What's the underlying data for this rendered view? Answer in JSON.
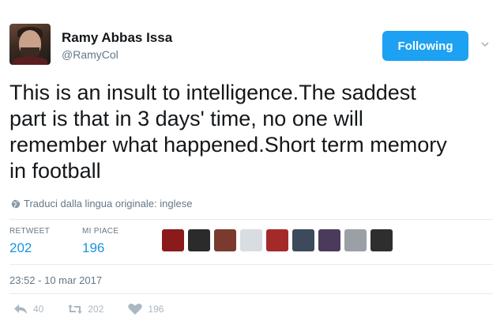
{
  "author": {
    "name": "Ramy Abbas Issa",
    "handle": "@RamyCol"
  },
  "follow_button": {
    "label": "Following"
  },
  "tweet": {
    "text": "This is an insult to intelligence.The saddest\npart is that in 3 days' time, no one will\nremember what happened.Short term memory\nin football"
  },
  "translate": {
    "label": "Traduci dalla lingua originale: inglese",
    "icon": "globe-icon"
  },
  "stats": {
    "retweets_label": "RETWEET",
    "retweets_value": "202",
    "likes_label": "MI PIACE",
    "likes_value": "196"
  },
  "likers": [
    {
      "color": "#8b1a1a"
    },
    {
      "color": "#2b2b2b"
    },
    {
      "color": "#7a3b2e"
    },
    {
      "color": "#d8dde2"
    },
    {
      "color": "#a42a2a"
    },
    {
      "color": "#3c4a5c"
    },
    {
      "color": "#4a3b5c"
    },
    {
      "color": "#9aa0a6"
    },
    {
      "color": "#2e2e2e"
    }
  ],
  "timestamp": "23:52 - 10 mar 2017",
  "actions": {
    "reply_count": "40",
    "retweet_count": "202",
    "like_count": "196"
  },
  "colors": {
    "accent": "#1da1f2",
    "link": "#1b95e0",
    "muted": "#657786",
    "icon": "#aab8c2"
  }
}
